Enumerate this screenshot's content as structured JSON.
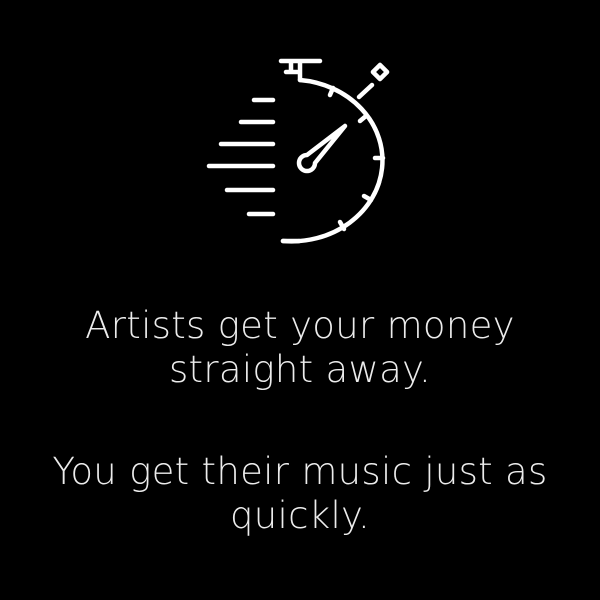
{
  "icon": "stopwatch-speed-icon",
  "colors": {
    "background": "#000000",
    "foreground": "#ffffff",
    "text": "#ececec"
  },
  "messages": [
    {
      "lines": [
        "Artists get your money",
        "straight away."
      ]
    },
    {
      "lines": [
        "You get their music just as",
        "quickly."
      ]
    }
  ]
}
